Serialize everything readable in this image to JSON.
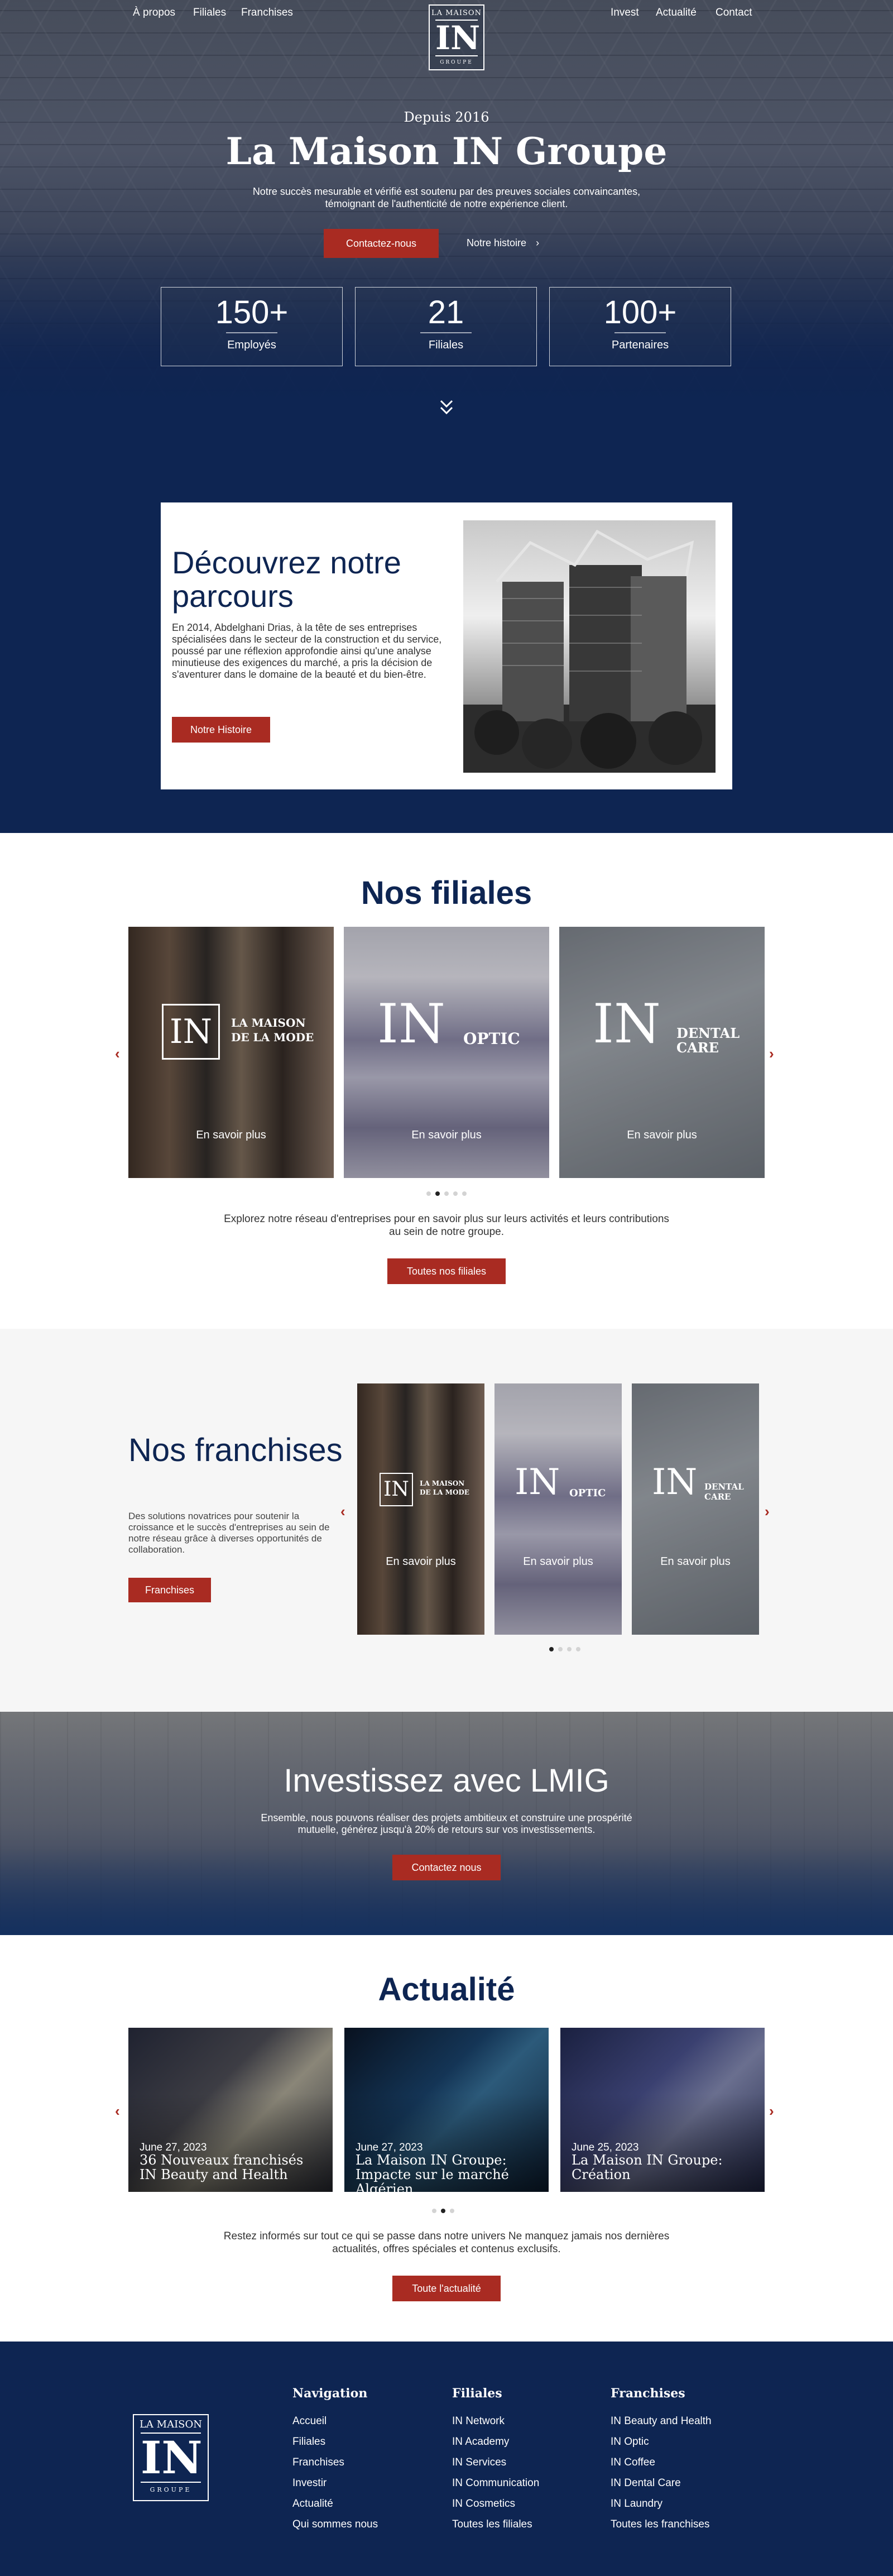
{
  "nav": {
    "left": [
      "À propos",
      "Filiales",
      "Franchises"
    ],
    "right": [
      "Invest",
      "Actualité",
      "Contact"
    ],
    "logo": {
      "top": "LA MAISON",
      "mark": "IN",
      "bottom": "GROUPE"
    }
  },
  "hero": {
    "since": "Depuis 2016",
    "title": "La Maison IN Groupe",
    "subtitle": "Notre succès mesurable et vérifié est soutenu par des preuves sociales convaincantes, témoignant de l'authenticité de notre expérience client.",
    "cta": "Contactez-nous",
    "link": "Notre histoire",
    "stats": [
      {
        "value": "150+",
        "label": "Employés"
      },
      {
        "value": "21",
        "label": "Filiales"
      },
      {
        "value": "100+",
        "label": "Partenaires"
      }
    ]
  },
  "discover": {
    "title": "Découvrez notre parcours",
    "text": " En 2014, Abdelghani Drias, à la tête de ses entreprises spécialisées dans le secteur de la construction et du service, poussé par une réflexion approfondie ainsi qu'une analyse minutieuse des exigences du marché, a pris la décision de s'aventurer dans le domaine de la beauté et du bien-être.",
    "button": "Notre Histoire"
  },
  "filiales": {
    "title": "Nos filiales",
    "cards": [
      {
        "brand_main": "IN",
        "brand_sub1": "LA MAISON",
        "brand_sub2": "DE LA MODE",
        "more": "En savoir plus"
      },
      {
        "brand_main": "IN",
        "brand_sub1": "OPTIC",
        "brand_sub2": "",
        "more": "En savoir plus"
      },
      {
        "brand_main": "IN",
        "brand_sub1": "DENTAL",
        "brand_sub2": "CARE",
        "more": "En savoir plus"
      }
    ],
    "text": "Explorez notre réseau d'entreprises pour en savoir plus sur leurs activités et leurs contributions au sein de notre groupe.",
    "button": "Toutes nos filiales"
  },
  "franchises": {
    "title": "Nos franchises",
    "text": "Des solutions novatrices pour soutenir la croissance et le succès d'entreprises au sein de notre réseau grâce à diverses opportunités de collaboration.",
    "button": "Franchises",
    "cards": [
      {
        "more": "En savoir plus"
      },
      {
        "more": "En savoir plus"
      },
      {
        "more": "En savoir plus"
      }
    ]
  },
  "invest": {
    "title": "Investissez avec LMIG",
    "text": "Ensemble, nous pouvons réaliser des projets ambitieux et construire une prospérité mutuelle, générez jusqu'à 20% de retours sur vos investissements.",
    "button": "Contactez nous"
  },
  "news": {
    "title": "Actualité",
    "items": [
      {
        "date": "June 27, 2023",
        "title": "36 Nouveaux franchisés IN Beauty and Health"
      },
      {
        "date": "June 27, 2023",
        "title": "La Maison IN Groupe: Impacte sur le marché Algérien."
      },
      {
        "date": "June 25, 2023",
        "title": "La Maison IN Groupe: Création"
      }
    ],
    "text": "Restez informés sur tout ce qui se passe dans notre univers Ne manquez jamais nos dernières actualités, offres spéciales et contenus exclusifs.",
    "button": "Toute l'actualité"
  },
  "footer": {
    "logo": {
      "top": "LA MAISON",
      "mark": "IN",
      "bottom": "GROUPE"
    },
    "navigation": {
      "title": "Navigation",
      "links": [
        "Accueil",
        "Filiales",
        "Franchises",
        "Investir",
        "Actualité",
        "Qui sommes nous"
      ]
    },
    "filiales": {
      "title": "Filiales",
      "links": [
        "IN Network",
        "IN Academy",
        "IN Services",
        "IN Communication",
        "IN Cosmetics",
        "Toutes les filiales"
      ]
    },
    "franchises": {
      "title": "Franchises",
      "links": [
        "IN Beauty and Health",
        "IN Optic",
        "IN Coffee",
        "IN Dental Care",
        "IN Laundry",
        "Toutes les franchises"
      ]
    }
  },
  "colors": {
    "navy": "#0e2552",
    "accent_red": "#a92b22"
  }
}
